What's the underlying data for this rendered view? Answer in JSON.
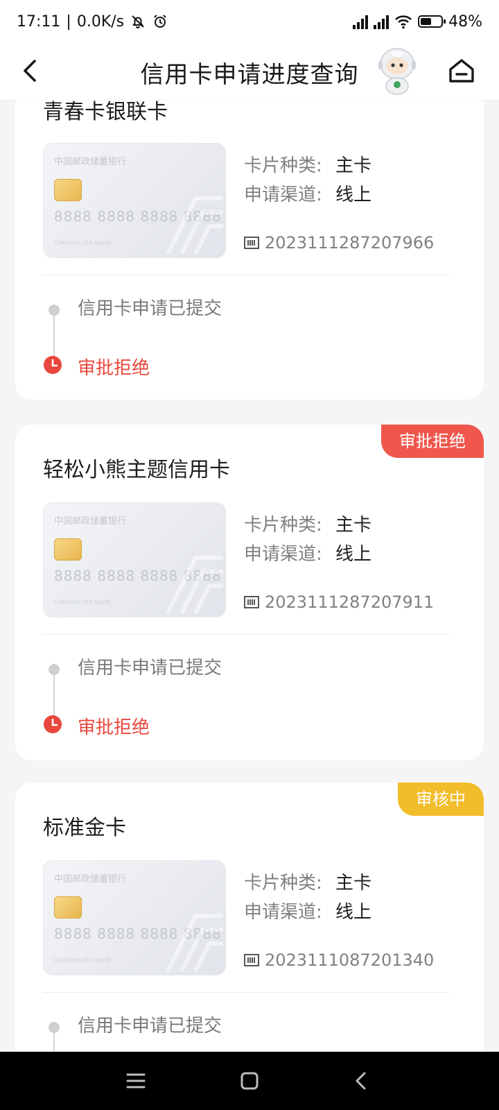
{
  "status_bar": {
    "time": "17:11",
    "net_speed": "0.0K/s",
    "battery": "48%",
    "battery_level": 0.48
  },
  "header": {
    "title": "信用卡申请进度查询"
  },
  "cards": [
    {
      "name": "青春卡银联卡",
      "badge": "",
      "image": {
        "bank": "中国邮政储蓄银行",
        "number": "8888 8888 8888 8888",
        "holder": "CARDHOLDER NAME"
      },
      "type_label": "卡片种类:",
      "type_value": "主卡",
      "channel_label": "申请渠道:",
      "channel_value": "线上",
      "app_no": "2023111287207966",
      "steps": [
        "信用卡申请已提交",
        "审批拒绝"
      ]
    },
    {
      "name": "轻松小熊主题信用卡",
      "badge": "审批拒绝",
      "badge_color": "#f0574c",
      "image": {
        "bank": "中国邮政储蓄银行",
        "number": "8888 8888 8888 8888",
        "holder": "CARDHOLDER NAME"
      },
      "type_label": "卡片种类:",
      "type_value": "主卡",
      "channel_label": "申请渠道:",
      "channel_value": "线上",
      "app_no": "2023111287207911",
      "steps": [
        "信用卡申请已提交",
        "审批拒绝"
      ]
    },
    {
      "name": "标准金卡",
      "badge": "审核中",
      "badge_color": "#f2bd2a",
      "image": {
        "bank": "中国邮政储蓄银行",
        "number": "8888 8888 8888 8888",
        "holder": "CARDHOLDER NAME"
      },
      "type_label": "卡片种类:",
      "type_value": "主卡",
      "channel_label": "申请渠道:",
      "channel_value": "线上",
      "app_no": "2023111087201340",
      "steps": [
        "信用卡申请已提交"
      ]
    }
  ],
  "icons": {
    "back": "chevron-left-icon",
    "home": "home-icon",
    "assistant": "robot-assistant-icon",
    "barcode": "barcode-icon",
    "clock": "clock-icon",
    "nav_menu": "menu-icon",
    "nav_home": "square-icon",
    "nav_back": "back-triangle-icon"
  },
  "colors": {
    "reject": "#e8473d",
    "review": "#f2bd2a"
  }
}
